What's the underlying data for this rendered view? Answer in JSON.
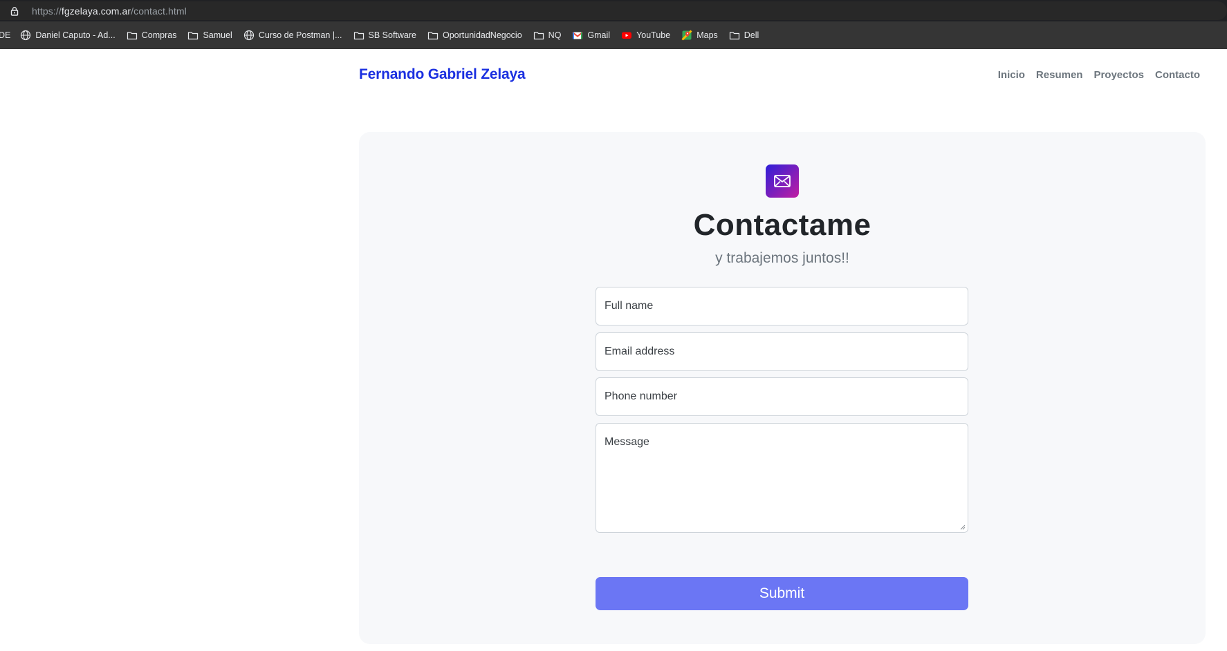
{
  "browser": {
    "url_scheme": "https://",
    "url_host": "fgzelaya.com.ar",
    "url_path": "/contact.html",
    "bookmarks_cut": "DE",
    "bookmarks": [
      {
        "label": "Daniel Caputo - Ad...",
        "icon": "globe-icon"
      },
      {
        "label": "Compras",
        "icon": "folder-icon"
      },
      {
        "label": "Samuel",
        "icon": "folder-icon"
      },
      {
        "label": "Curso de Postman |...",
        "icon": "globe-icon"
      },
      {
        "label": "SB Software",
        "icon": "folder-icon"
      },
      {
        "label": "OportunidadNegocio",
        "icon": "folder-icon"
      },
      {
        "label": "NQ",
        "icon": "folder-icon"
      },
      {
        "label": "Gmail",
        "icon": "gmail-icon"
      },
      {
        "label": "YouTube",
        "icon": "youtube-icon"
      },
      {
        "label": "Maps",
        "icon": "maps-icon"
      },
      {
        "label": "Dell",
        "icon": "folder-icon"
      }
    ]
  },
  "navbar": {
    "brand": "Fernando Gabriel Zelaya",
    "links": [
      "Inicio",
      "Resumen",
      "Proyectos",
      "Contacto"
    ]
  },
  "contact": {
    "icon": "envelope-icon",
    "title": "Contactame",
    "subtitle": "y trabajemos juntos!!",
    "fields": {
      "name_placeholder": "Full name",
      "email_placeholder": "Email address",
      "phone_placeholder": "Phone number",
      "message_placeholder": "Message"
    },
    "submit_label": "Submit"
  },
  "colors": {
    "brand": "#1a2fe0",
    "submit": "#6b76f4",
    "icon_gradient_start": "#2e1fd8",
    "icon_gradient_end": "#c11ea2"
  }
}
